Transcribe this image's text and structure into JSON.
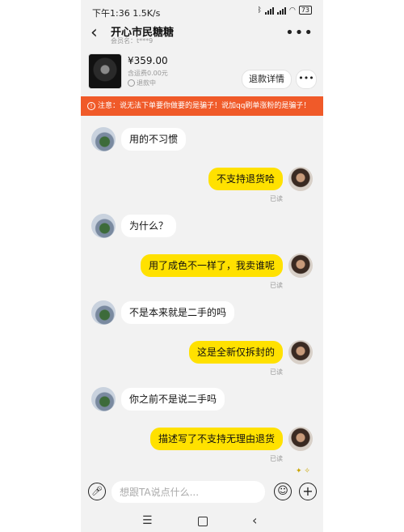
{
  "status": {
    "time": "下午1:36",
    "speed": "1.5K/s",
    "battery": "73"
  },
  "header": {
    "title": "开心市民糖糖",
    "subtitle": "会员名：t***9"
  },
  "product": {
    "price": "¥359.00",
    "shipping": "含运费0.00元",
    "status": "退款中",
    "refund_button": "退款详情"
  },
  "warning": "注意：说无法下单要你做要的是骗子！说加qq刷单涨粉的是骗子！",
  "messages": [
    {
      "side": "left",
      "text": "用的不习惯"
    },
    {
      "side": "right",
      "text": "不支持退货哈",
      "read": "已读"
    },
    {
      "side": "left",
      "text": "为什么？"
    },
    {
      "side": "right",
      "text": "用了成色不一样了，我卖谁呢",
      "read": "已读"
    },
    {
      "side": "left",
      "text": "不是本来就是二手的吗"
    },
    {
      "side": "right",
      "text": "这是全新仅拆封的",
      "read": "已读"
    },
    {
      "side": "left",
      "text": "你之前不是说二手吗"
    },
    {
      "side": "right",
      "text": "描述写了不支持无理由退货",
      "read": "已读"
    }
  ],
  "input": {
    "placeholder": "想跟TA说点什么..."
  }
}
